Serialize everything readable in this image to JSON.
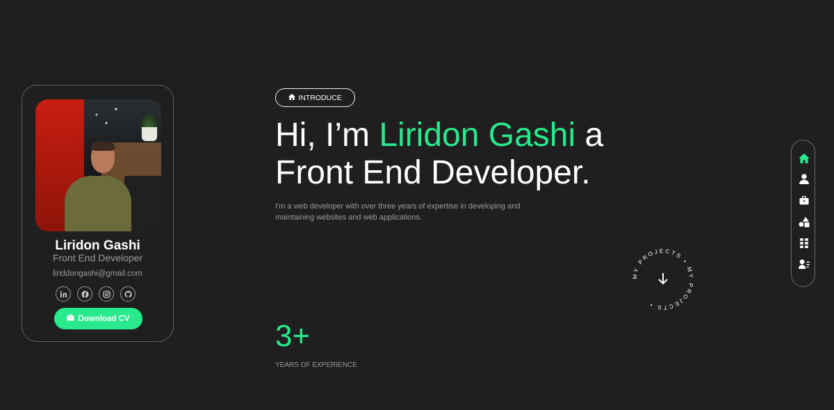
{
  "profile": {
    "name": "Liridon Gashi",
    "role": "Front End Developer",
    "email": "liriddongashi@gmail.com",
    "socials": [
      {
        "icon": "linkedin-icon",
        "label": "in"
      },
      {
        "icon": "facebook-icon",
        "label": "f"
      },
      {
        "icon": "instagram-icon",
        "label": "ig"
      },
      {
        "icon": "github-icon",
        "label": "gh"
      }
    ],
    "download_label": "Download CV"
  },
  "intro": {
    "pill_label": "INTRODUCE",
    "headline_pre": "Hi, I’m ",
    "headline_name": "Liridon Gashi",
    "headline_post": " a",
    "headline_line2": "Front End Developer.",
    "description": "I'm a web developer with over three years of expertise in developing and maintaining websites and web applications."
  },
  "stats": {
    "number": "3+",
    "label": "YEARS OF EXPERIENCE"
  },
  "projects_badge": {
    "text": "MY PROJECTS • MY PROJECTS •",
    "icon": "arrow-down-icon"
  },
  "nav": {
    "items": [
      {
        "icon": "home-icon",
        "active": true
      },
      {
        "icon": "user-icon",
        "active": false
      },
      {
        "icon": "briefcase-icon",
        "active": false
      },
      {
        "icon": "shapes-icon",
        "active": false
      },
      {
        "icon": "grid-icon",
        "active": false
      },
      {
        "icon": "contact-icon",
        "active": false
      }
    ]
  },
  "colors": {
    "background": "#1f1f1f",
    "accent": "#28e98c",
    "muted_text": "#9b9b9b",
    "border": "#5f5f5f"
  }
}
